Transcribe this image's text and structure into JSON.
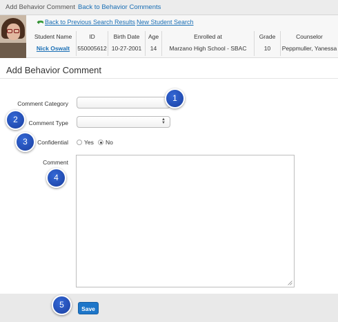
{
  "tabs": {
    "active": "Add Behavior Comment",
    "link": "Back to Behavior Comments"
  },
  "nav": {
    "prev_results": "Back to Previous Search Results",
    "new_search": "New Student Search"
  },
  "student": {
    "headers": [
      "Student Name",
      "ID",
      "Birth Date",
      "Age",
      "Enrolled at",
      "Grade",
      "Counselor"
    ],
    "values": [
      "Nick Oswalt",
      "550005612",
      "10-27-2001",
      "14",
      "Marzano High School - SBAC",
      "10",
      "Peppmuller, Yanessa"
    ]
  },
  "page_title": "Add Behavior Comment",
  "form": {
    "category_label": "Comment Category",
    "category_value": "",
    "type_label": "Comment Type",
    "type_value": "",
    "confidential_label": "Confidential",
    "yes_label": "Yes",
    "no_label": "No",
    "confidential_selected": "No",
    "comment_label": "Comment",
    "comment_value": ""
  },
  "save_label": "Save",
  "badges": [
    "1",
    "2",
    "3",
    "4",
    "5"
  ],
  "colors": {
    "link": "#1a6fb5",
    "save_button": "#1d76c9",
    "badge": "#2451c2"
  }
}
